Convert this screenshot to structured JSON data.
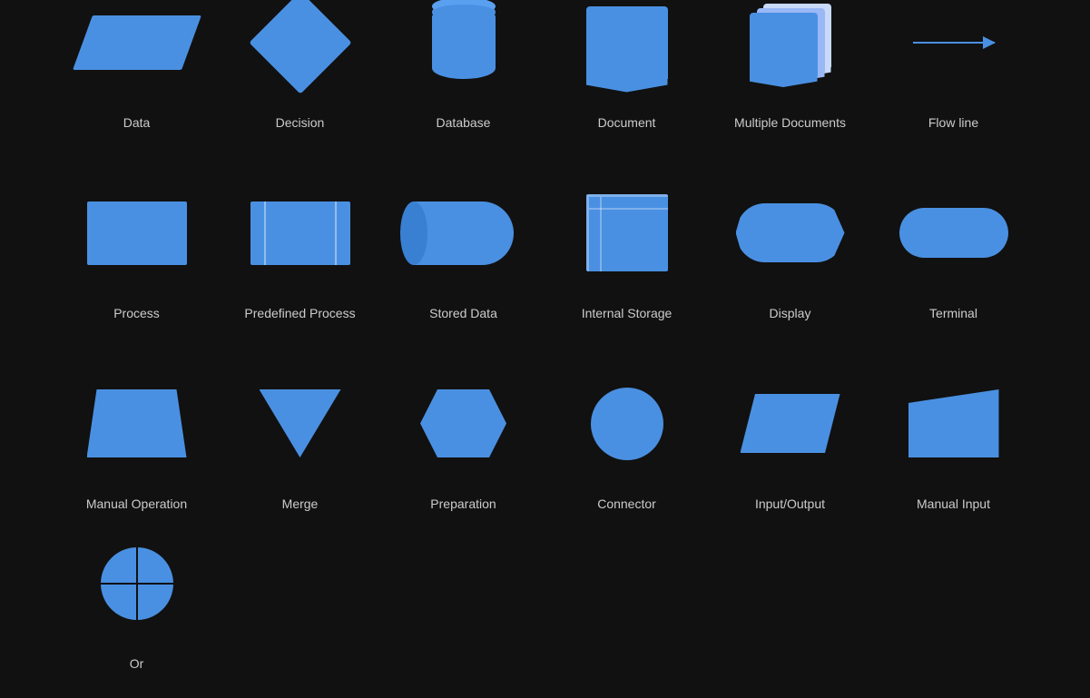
{
  "shapes": {
    "row1": [
      {
        "id": "data",
        "label": "Data"
      },
      {
        "id": "decision",
        "label": "Decision"
      },
      {
        "id": "database",
        "label": "Database"
      },
      {
        "id": "document",
        "label": "Document"
      },
      {
        "id": "multiple-documents",
        "label": "Multiple Documents"
      },
      {
        "id": "flow-line",
        "label": "Flow line"
      }
    ],
    "row2": [
      {
        "id": "process",
        "label": "Process"
      },
      {
        "id": "predefined-process",
        "label": "Predefined Process"
      },
      {
        "id": "stored-data",
        "label": "Stored Data"
      },
      {
        "id": "internal-storage",
        "label": "Internal Storage"
      },
      {
        "id": "display",
        "label": "Display"
      },
      {
        "id": "terminal",
        "label": "Terminal"
      }
    ],
    "row3": [
      {
        "id": "manual-operation",
        "label": "Manual Operation"
      },
      {
        "id": "merge",
        "label": "Merge"
      },
      {
        "id": "preparation",
        "label": "Preparation"
      },
      {
        "id": "connector",
        "label": "Connector"
      },
      {
        "id": "input-output",
        "label": "Input/Output"
      },
      {
        "id": "manual-input",
        "label": "Manual Input"
      },
      {
        "id": "or",
        "label": "Or"
      }
    ]
  }
}
